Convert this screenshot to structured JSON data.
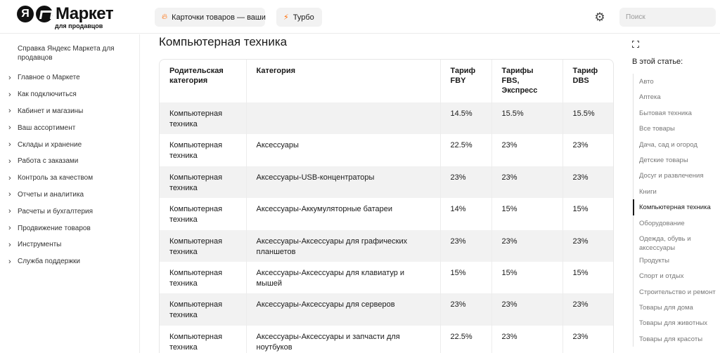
{
  "header": {
    "logo_text": "Маркет",
    "logo_letter": "Я",
    "logo_sub": "для продавцов",
    "pill_cards": "Карточки товаров — ваши",
    "pill_turbo": "Турбо",
    "search_placeholder": "Поиск"
  },
  "sidebar": {
    "heading": "Справка Яндекс Маркета для продавцов",
    "items": [
      "Главное о Маркете",
      "Как подключиться",
      "Кабинет и магазины",
      "Ваш ассортимент",
      "Склады и хранение",
      "Работа с заказами",
      "Контроль за качеством",
      "Отчеты и аналитика",
      "Расчеты и бухгалтерия",
      "Продвижение товаров",
      "Инструменты",
      "Служба поддержки"
    ]
  },
  "main": {
    "title": "Компьютерная техника",
    "table": {
      "headers": [
        "Родительская категория",
        "Категория",
        "Тариф FBY",
        "Тарифы FBS, Экспресс",
        "Тариф DBS"
      ],
      "rows": [
        [
          "Компьютерная техника",
          "",
          "14.5%",
          "15.5%",
          "15.5%"
        ],
        [
          "Компьютерная техника",
          "Аксессуары",
          "22.5%",
          "23%",
          "23%"
        ],
        [
          "Компьютерная техника",
          "Аксессуары-USB-концентраторы",
          "23%",
          "23%",
          "23%"
        ],
        [
          "Компьютерная техника",
          "Аксессуары-Аккумуляторные батареи",
          "14%",
          "15%",
          "15%"
        ],
        [
          "Компьютерная техника",
          "Аксессуары-Аксессуары для графических планшетов",
          "23%",
          "23%",
          "23%"
        ],
        [
          "Компьютерная техника",
          "Аксессуары-Аксессуары для клавиатур и мышей",
          "15%",
          "15%",
          "15%"
        ],
        [
          "Компьютерная техника",
          "Аксессуары-Аксессуары для серверов",
          "23%",
          "23%",
          "23%"
        ],
        [
          "Компьютерная техника",
          "Аксессуары-Аксессуары и запчасти для ноутбуков",
          "22.5%",
          "23%",
          "23%"
        ]
      ]
    }
  },
  "toc": {
    "title": "В этой статье:",
    "items": [
      "Авто",
      "Аптека",
      "Бытовая техника",
      "Все товары",
      "Дача, сад и огород",
      "Детские товары",
      "Досуг и развлечения",
      "Книги",
      "Компьютерная техника",
      "Оборудование",
      "Одежда, обувь и аксессуары",
      "Продукты",
      "Спорт и отдых",
      "Строительство и ремонт",
      "Товары для дома",
      "Товары для животных",
      "Товары для красоты"
    ],
    "active_index": 8
  }
}
